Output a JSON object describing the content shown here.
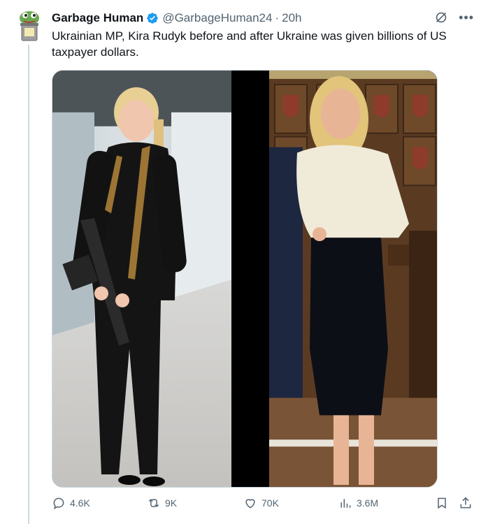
{
  "author": {
    "display_name": "Garbage Human",
    "handle": "@GarbageHuman24",
    "separator": "·",
    "time": "20h",
    "verified": true,
    "avatar_icon": "frog-in-trash-can-avatar"
  },
  "tweet": {
    "text": "Ukrainian MP, Kira Rudyk before and after Ukraine was given billions of US taxpayer dollars."
  },
  "media": {
    "images": [
      {
        "name": "woman-in-black-holding-rifle-photo"
      },
      {
        "name": "woman-in-cream-sweater-photo"
      }
    ]
  },
  "actions": {
    "replies": "4.6K",
    "reposts": "9K",
    "likes": "70K",
    "views": "3.6M"
  },
  "colors": {
    "text": "#0f1419",
    "secondary": "#536471",
    "verified": "#1d9bf0",
    "border": "#cfd9de"
  }
}
